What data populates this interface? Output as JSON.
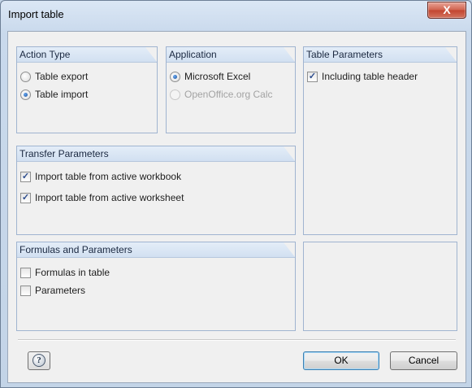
{
  "window": {
    "title": "Import table",
    "close_glyph": "X"
  },
  "groups": {
    "action_type": {
      "title": "Action Type",
      "options": [
        {
          "label": "Table export",
          "selected": false
        },
        {
          "label": "Table import",
          "selected": true
        }
      ]
    },
    "application": {
      "title": "Application",
      "options": [
        {
          "label": "Microsoft Excel",
          "selected": true,
          "enabled": true
        },
        {
          "label": "OpenOffice.org Calc",
          "selected": false,
          "enabled": false
        }
      ]
    },
    "table_parameters": {
      "title": "Table Parameters",
      "options": [
        {
          "label": "Including table header",
          "checked": true
        }
      ]
    },
    "transfer_parameters": {
      "title": "Transfer Parameters",
      "options": [
        {
          "label": "Import table from active workbook",
          "checked": true
        },
        {
          "label": "Import table from active worksheet",
          "checked": true
        }
      ]
    },
    "formulas_parameters": {
      "title": "Formulas and Parameters",
      "options": [
        {
          "label": "Formulas in table",
          "checked": false
        },
        {
          "label": "Parameters",
          "checked": false
        }
      ]
    }
  },
  "buttons": {
    "ok": "OK",
    "cancel": "Cancel",
    "help_glyph": "?"
  },
  "colors": {
    "titlebar": "#c3d4e7",
    "close_button": "#c24530",
    "group_header": "#d2e0f1",
    "dialog_bg": "#f0f0f0"
  },
  "icons": {
    "close": "close-icon",
    "help": "help-icon"
  }
}
